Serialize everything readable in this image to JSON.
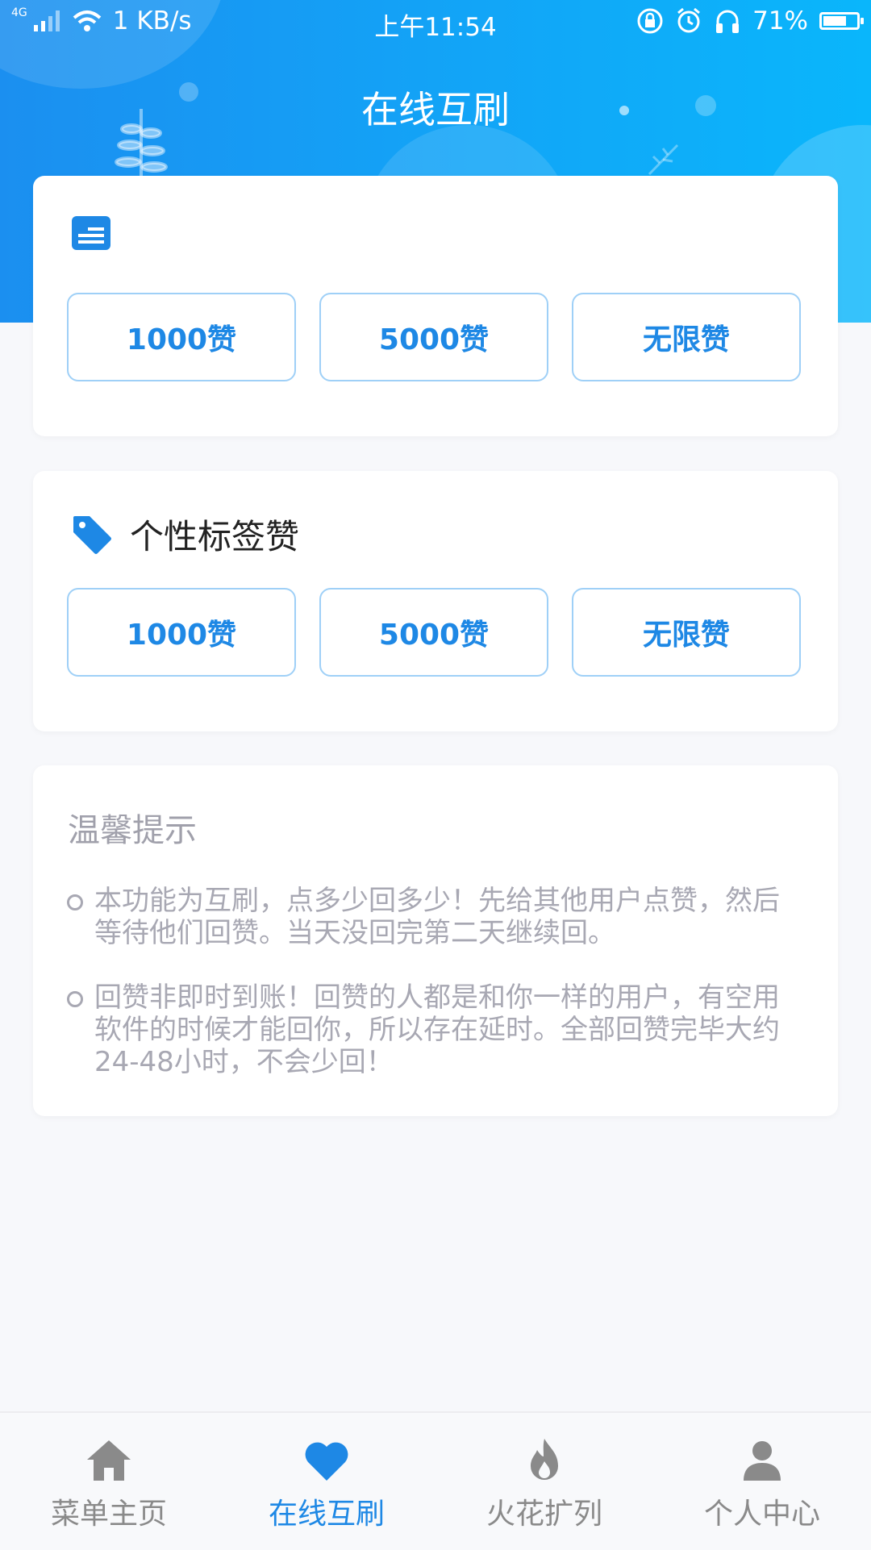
{
  "status_bar": {
    "signal_label": "4G",
    "network_speed": "1 KB/s",
    "time": "上午11:54",
    "battery_percent": "71%",
    "battery_level": 0.71
  },
  "header": {
    "title": "在线互刷"
  },
  "sections": [
    {
      "title": "",
      "icon": "card-icon",
      "buttons": [
        "1000赞",
        "5000赞",
        "无限赞"
      ]
    },
    {
      "title": "个性标签赞",
      "icon": "tag-icon",
      "buttons": [
        "1000赞",
        "5000赞",
        "无限赞"
      ]
    }
  ],
  "tips": {
    "title": "温馨提示",
    "items": [
      "本功能为互刷，点多少回多少！先给其他用户点赞，然后等待他们回赞。当天没回完第二天继续回。",
      "回赞非即时到账！回赞的人都是和你一样的用户，有空用软件的时候才能回你，所以存在延时。全部回赞完毕大约24-48小时，不会少回！"
    ]
  },
  "bottom_nav": [
    {
      "label": "菜单主页",
      "icon": "home-icon",
      "active": false
    },
    {
      "label": "在线互刷",
      "icon": "heart-icon",
      "active": true
    },
    {
      "label": "火花扩列",
      "icon": "flame-icon",
      "active": false
    },
    {
      "label": "个人中心",
      "icon": "person-icon",
      "active": false
    }
  ],
  "colors": {
    "accent": "#1e88e5",
    "header_gradient_start": "#1b8ff0",
    "header_gradient_end": "#0ab6fb",
    "button_border": "#9fd0f7",
    "tip_text": "#a8a8b3",
    "nav_inactive": "#8a8a8a"
  }
}
